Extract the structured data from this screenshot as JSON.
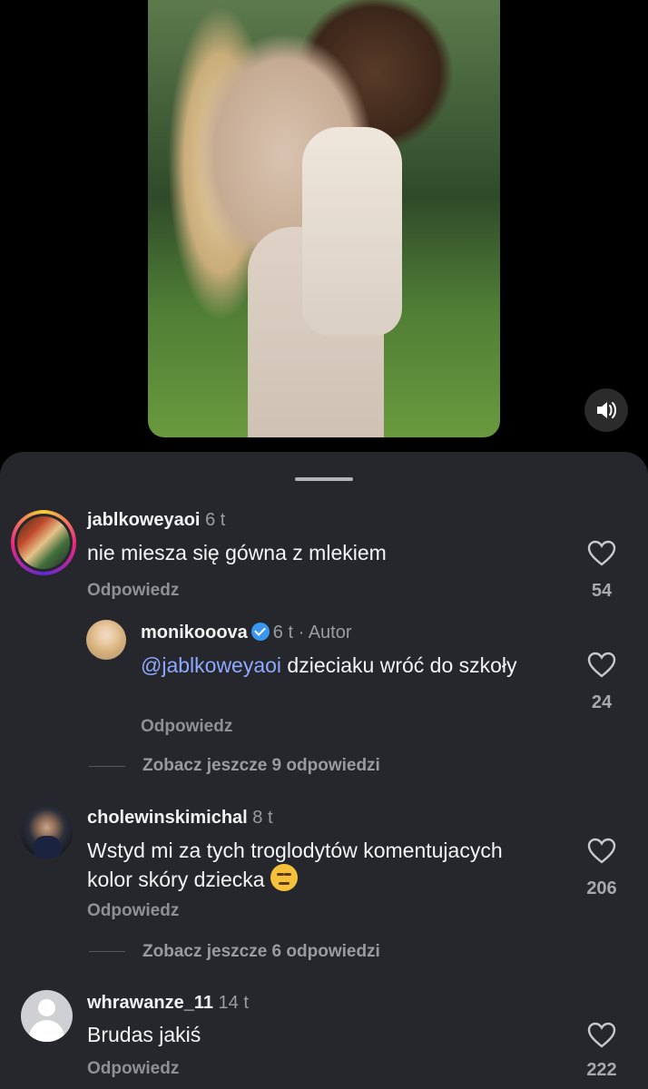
{
  "video": {
    "sound_icon": "speaker-icon"
  },
  "comments": [
    {
      "username": "jablkoweyaoi",
      "time": "6 t",
      "text": "nie miesza się gówna z mlekiem",
      "reply_label": "Odpowiedz",
      "likes": "54",
      "replies": [
        {
          "username": "monikooova",
          "time": "6 t",
          "author_label": "Autor",
          "mention": "@jablkoweyaoi",
          "text": " dzieciaku wróć do szkoły",
          "reply_label": "Odpowiedz",
          "likes": "24"
        }
      ],
      "more_replies": "Zobacz jeszcze 9 odpowiedzi"
    },
    {
      "username": "cholewinskimichal",
      "time": "8 t",
      "text": "Wstyd mi za tych troglodytów komentujacych kolor skóry dziecka",
      "reply_label": "Odpowiedz",
      "likes": "206",
      "more_replies": "Zobacz jeszcze 6 odpowiedzi"
    },
    {
      "username": "whrawanze_11",
      "time": "14 t",
      "text": "Brudas jakiś",
      "reply_label": "Odpowiedz",
      "likes": "222"
    }
  ]
}
